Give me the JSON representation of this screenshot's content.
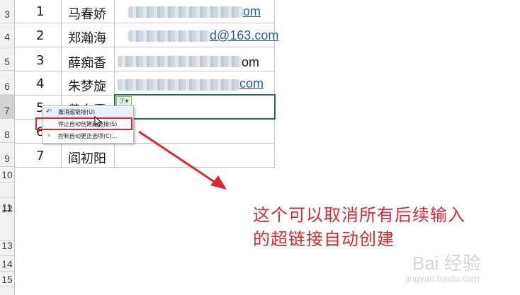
{
  "row_headers": [
    "3",
    "4",
    "5",
    "6",
    "7",
    "8",
    "9",
    "10",
    "11",
    "12",
    "13",
    "14",
    "15"
  ],
  "rows": [
    {
      "num": "1",
      "name": "马春娇",
      "email_suffix": "om",
      "email_style": "link"
    },
    {
      "num": "2",
      "name": "郑瀚海",
      "email_suffix": "d@163.com",
      "email_style": "link"
    },
    {
      "num": "3",
      "name": "薛痴香",
      "email_suffix": "om",
      "email_style": "plain"
    },
    {
      "num": "4",
      "name": "朱梦旋",
      "email_suffix": "com",
      "email_style": "link"
    },
    {
      "num": "5",
      "name": "黄白露",
      "email_suffix": "",
      "email_style": "none"
    },
    {
      "num": "6",
      "name": "",
      "email_suffix": "",
      "email_style": "none"
    },
    {
      "num": "7",
      "name": "阎初阳",
      "email_suffix": "",
      "email_style": "none"
    }
  ],
  "context_menu": {
    "items": [
      {
        "label": "撤消超链接(U)",
        "icon": "undo-icon"
      },
      {
        "label": "停止自动创建超链接(S)",
        "icon": ""
      },
      {
        "label": "控制自动更正选项(C)...",
        "icon": "autocorrect-icon"
      }
    ]
  },
  "annotation": {
    "line1": "这个可以取消所有后续输入",
    "line2": "的超链接自动创建"
  },
  "watermark": {
    "main": "Bai 经验",
    "sub": "jingyan.baidu.com"
  },
  "colors": {
    "annotation_red": "#e0262f",
    "hyperlink_blue": "#2b5ea8",
    "active_cell_green": "#217346"
  }
}
